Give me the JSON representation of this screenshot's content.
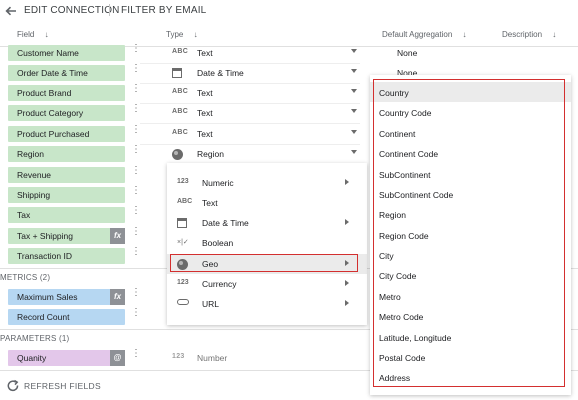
{
  "header": {
    "title": "EDIT CONNECTION",
    "filter": "FILTER BY EMAIL"
  },
  "columns": {
    "field": "Field",
    "type": "Type",
    "aggregation": "Default Aggregation",
    "description": "Description"
  },
  "dimensions": [
    {
      "name": "Customer Name",
      "type_icon": "ABC",
      "type": "Text",
      "agg": "None"
    },
    {
      "name": "Order Date & Time",
      "type_icon": "calendar-icon",
      "type": "Date & Time",
      "agg": "None"
    },
    {
      "name": "Product Brand",
      "type_icon": "ABC",
      "type": "Text"
    },
    {
      "name": "Product Category",
      "type_icon": "ABC",
      "type": "Text"
    },
    {
      "name": "Product Purchased",
      "type_icon": "ABC",
      "type": "Text"
    },
    {
      "name": "Region",
      "type_icon": "globe-icon",
      "type": "Region"
    },
    {
      "name": "Revenue"
    },
    {
      "name": "Shipping"
    },
    {
      "name": "Tax"
    },
    {
      "name": "Tax + Shipping",
      "badge": "fx"
    },
    {
      "name": "Transaction ID"
    }
  ],
  "metrics_header": "METRICS (2)",
  "metrics": [
    {
      "name": "Maximum Sales",
      "badge": "fx"
    },
    {
      "name": "Record Count"
    }
  ],
  "parameters_header": "PARAMETERS (1)",
  "parameters": [
    {
      "name": "Quanity",
      "badge": "@",
      "type_icon": "123",
      "type": "Number"
    }
  ],
  "refresh_label": "REFRESH FIELDS",
  "type_menu": [
    {
      "icon": "123",
      "label": "Numeric",
      "submenu": true
    },
    {
      "icon": "ABC",
      "label": "Text",
      "submenu": false
    },
    {
      "icon": "calendar-icon",
      "label": "Date & Time",
      "submenu": true
    },
    {
      "icon": "boolean-icon",
      "label": "Boolean",
      "submenu": false
    },
    {
      "icon": "globe-icon",
      "label": "Geo",
      "submenu": true,
      "selected": true
    },
    {
      "icon": "123",
      "label": "Currency",
      "submenu": true
    },
    {
      "icon": "link-icon",
      "label": "URL",
      "submenu": true
    }
  ],
  "geo_menu": [
    "Country",
    "Country Code",
    "Continent",
    "Continent Code",
    "SubContinent",
    "SubContinent Code",
    "Region",
    "Region Code",
    "City",
    "City Code",
    "Metro",
    "Metro Code",
    "Latitude, Longitude",
    "Postal Code",
    "Address"
  ],
  "colors": {
    "dimension": "#c8e6c9",
    "metric": "#b6d7f2",
    "parameter": "#e3c7ea",
    "highlight": "#d32f2f"
  }
}
